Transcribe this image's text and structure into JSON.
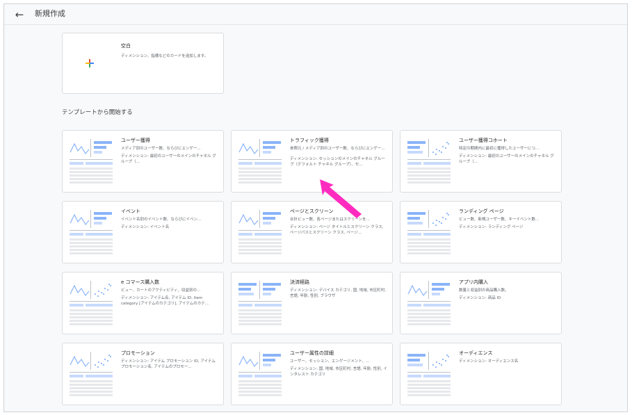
{
  "header": {
    "back_icon": "arrow-left-icon",
    "title": "新規作成"
  },
  "blank": {
    "title": "空白",
    "description": "ディメンション、指標などのカードを追加します。",
    "plus_colors": [
      "#4285f4",
      "#ea4335",
      "#fbbc04",
      "#34a853"
    ]
  },
  "section_title": "テンプレートから開始する",
  "colors": {
    "accent_blue": "#8ab4f8",
    "accent_light": "#c6dafc",
    "arrow": "#ff2bbf"
  },
  "templates": [
    {
      "title": "ユーザー獲得",
      "summary": "メディア別のユーザー数、ならびにエンゲー...",
      "dims": "ディメンション: 最初のユーザーのメインのチャネル グループ（...",
      "thumb": "line-bars"
    },
    {
      "title": "トラフィック獲得",
      "summary": "参照元 / メディア別のユーザー数、ならびにエンゲー...",
      "dims": "ディメンション: セッションのメインのチャネル グループ（デフォルト チャネル グループ）、セ...",
      "thumb": "line-bars"
    },
    {
      "title": "ユーザー獲得コホート",
      "summary": "特定の期間内に最初に獲得したユーザーにつ...",
      "dims": "ディメンション: 最初のユーザーのメインのチャネル グループ（...",
      "thumb": "bars-scatter"
    },
    {
      "title": "イベント",
      "summary": "イベント名別のイベント数、ならびにイベン...",
      "dims": "ディメンション: イベント名",
      "thumb": "line-bars"
    },
    {
      "title": "ページとスクリーン",
      "summary": "合計ビュー数、各ページまたはスクリーンを...",
      "dims": "ディメンション: ページ タイトルとスクリーン クラス, ページパスとスクリーン クラス, ページ...",
      "thumb": "line-bars"
    },
    {
      "title": "ランディング ページ",
      "summary": "ビュー数、新規ユーザー数、キーイベント数...",
      "dims": "ディメンション: ランディング ページ",
      "thumb": "bars-scatter"
    },
    {
      "title": "e コマース購入数",
      "summary": "ビュー、カートのアクティビティ、収益別の...",
      "dims": "ディメンション: アイテム名, アイテム ID, Item category [アイテムのカテゴリ], アイテムのカテ...",
      "thumb": "line-scatter"
    },
    {
      "title": "決済経路",
      "summary": "",
      "dims": "ディメンション: デバイス カテゴリ, 国, 地域, 市区町村, 言語, 年齢, 性別, ブラウザ",
      "thumb": "bars-bars"
    },
    {
      "title": "アプリ内購入",
      "summary": "数量と収益別の商品購入数。",
      "dims": "ディメンション: 商品 ID",
      "thumb": "line-bars"
    },
    {
      "title": "プロモーション",
      "summary": "",
      "dims": "ディメンション: アイテム プロモーション ID, アイテム プロモーション名, アイテムのプロモー...",
      "thumb": "line-scatter"
    },
    {
      "title": "ユーザー属性の詳細",
      "summary": "ユーザー、セッション、エンゲージメント、...",
      "dims": "ディメンション: 国, 地域, 市区町村, 言語, 年齢, 性別, インタレスト カテゴリ",
      "thumb": "line-bars"
    },
    {
      "title": "オーディエンス",
      "summary": "",
      "dims": "ディメンション: オーディエンス名",
      "thumb": "bars-scatter"
    }
  ]
}
